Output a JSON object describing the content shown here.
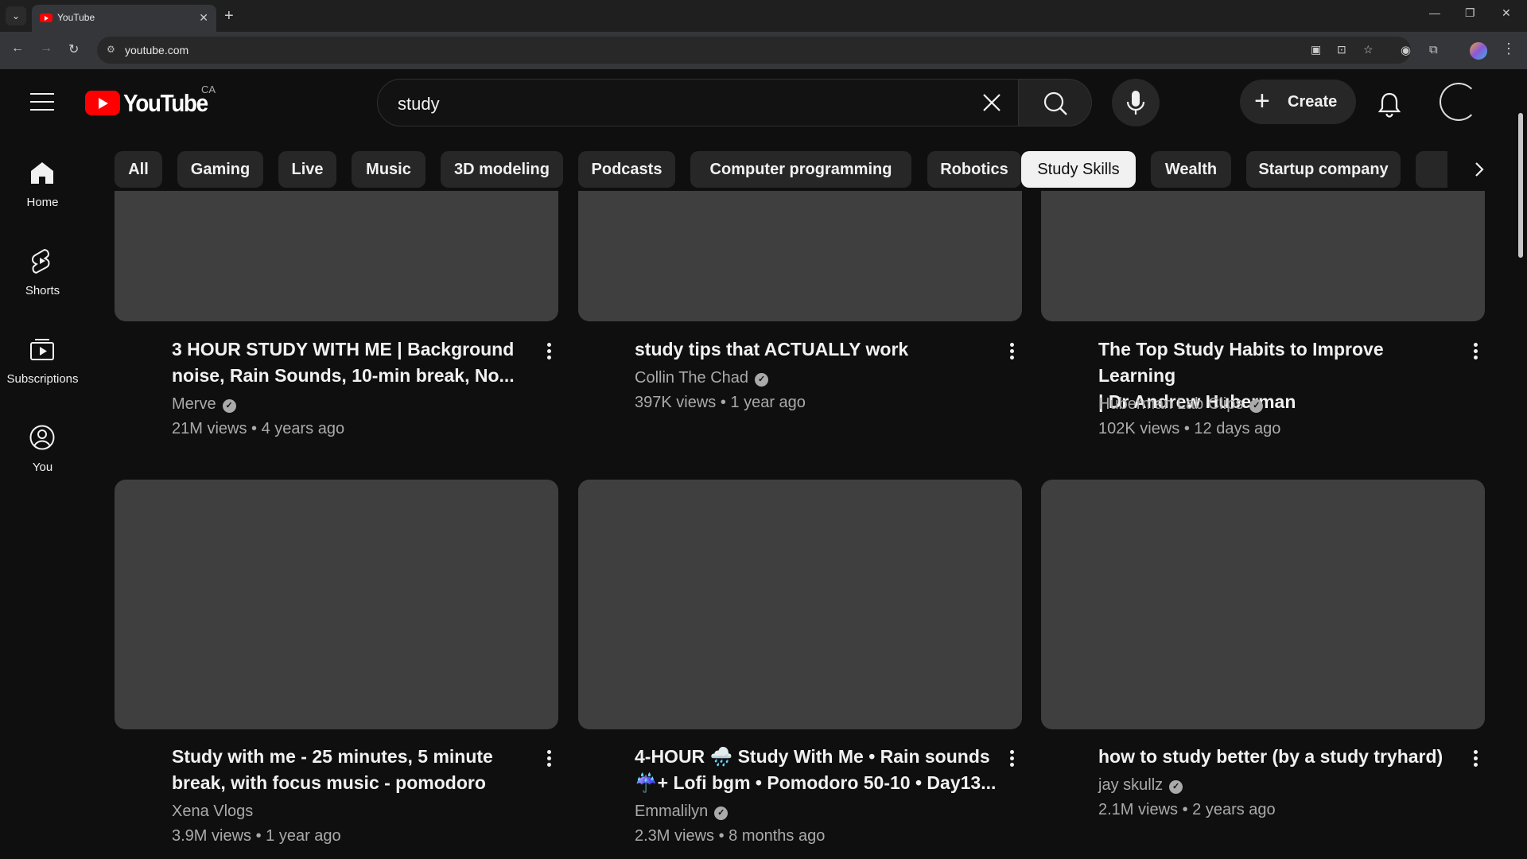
{
  "browser": {
    "tab_title": "YouTube",
    "url": "youtube.com",
    "new_tab_icon": "plus-icon",
    "window_controls": [
      "minimize-icon",
      "restore-icon",
      "close-icon"
    ]
  },
  "header": {
    "logo_text": "YouTube",
    "country_code": "CA",
    "search_value": "study",
    "create_label": "Create",
    "brand_color": "#ff0000"
  },
  "sidebar": {
    "items": [
      {
        "label": "Home",
        "icon": "home-icon"
      },
      {
        "label": "Shorts",
        "icon": "shorts-icon"
      },
      {
        "label": "Subscriptions",
        "icon": "subscriptions-icon"
      },
      {
        "label": "You",
        "icon": "user-circle-icon"
      }
    ]
  },
  "chips": {
    "items": [
      "All",
      "Gaming",
      "Live",
      "Music",
      "3D modeling",
      "Podcasts",
      "Computer programming",
      "Robotics",
      "Study Skills",
      "Wealth",
      "Startup company"
    ],
    "selected": "Study Skills"
  },
  "videos": [
    {
      "title_line1": "3 HOUR STUDY WITH ME | Background",
      "title_line2": "noise, Rain Sounds, 10-min break, No...",
      "channel": "Merve",
      "meta": "21M views • 4 years ago"
    },
    {
      "title_line1": "study tips that ACTUALLY work",
      "title_line2": "",
      "channel": "Collin The Chad",
      "meta": "397K views • 1 year ago"
    },
    {
      "title_line1": "The Top Study Habits to Improve Learning",
      "title_line2": "| Dr Andrew Huberman",
      "channel": "Huberman Lab Clips",
      "meta": "102K views • 12 days ago"
    },
    {
      "title_line1": "Study with me - 25 minutes, 5 minute",
      "title_line2": "break, with focus music - pomodoro",
      "channel": "Xena Vlogs",
      "meta": "3.9M views • 1 year ago"
    },
    {
      "title_line1": "4-HOUR 🌧️ Study With Me • Rain sounds",
      "title_line2": "☔+ Lofi bgm • Pomodoro 50-10 • Day13...",
      "channel": "Emmalilyn",
      "meta": "2.3M views • 8 months ago"
    },
    {
      "title_line1": "how to study better (by a study tryhard)",
      "title_line2": "",
      "channel": "jay skullz",
      "meta": "2.1M views • 2 years ago"
    }
  ]
}
